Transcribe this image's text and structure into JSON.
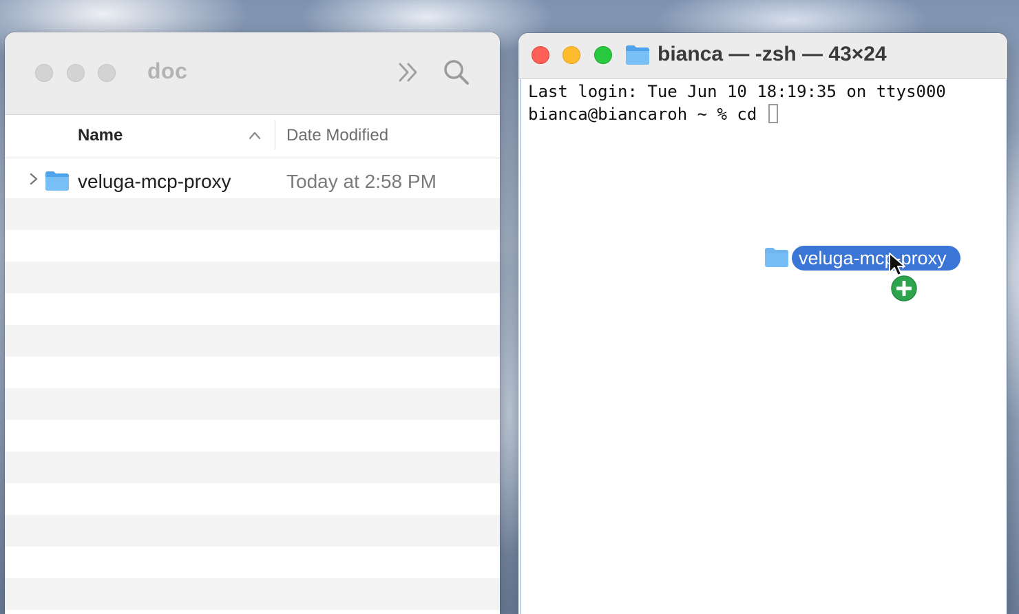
{
  "finder": {
    "title": "doc",
    "columns": {
      "name": "Name",
      "date_modified": "Date Modified"
    },
    "items": [
      {
        "name": "veluga-mcp-proxy",
        "date": "Today at 2:58 PM",
        "icon": "folder-icon"
      }
    ]
  },
  "terminal": {
    "title": "bianca — -zsh — 43×24",
    "lines": [
      "Last login: Tue Jun 10 18:19:35 on ttys000",
      "bianca@biancaroh ~ % cd "
    ]
  },
  "drag": {
    "label": "veluga-mcp-proxy",
    "badge_icon": "plus-badge-icon",
    "accent": "#3b75d6"
  },
  "colors": {
    "close": "#fe5f57",
    "minimize": "#febc2e",
    "zoom": "#28c840",
    "folder": "#6fb7f0",
    "copy_badge": "#2ea44f"
  }
}
